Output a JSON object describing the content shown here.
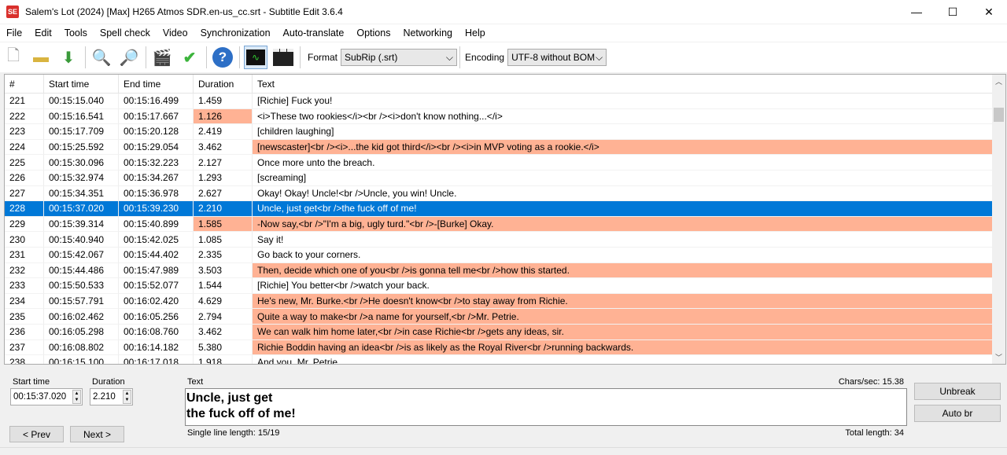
{
  "window": {
    "app_icon": "SE",
    "title": "Salem's Lot (2024) [Max] H265 Atmos SDR.en-us_cc.srt - Subtitle Edit 3.6.4",
    "minimize": "—",
    "maximize": "☐",
    "close": "✕"
  },
  "menu": [
    "File",
    "Edit",
    "Tools",
    "Spell check",
    "Video",
    "Synchronization",
    "Auto-translate",
    "Options",
    "Networking",
    "Help"
  ],
  "toolbar": {
    "format_label": "Format",
    "format_value": "SubRip (.srt)",
    "encoding_label": "Encoding",
    "encoding_value": "UTF-8 without BOM"
  },
  "colors": {
    "warning": "#ffb294",
    "selected": "#0078d7"
  },
  "grid": {
    "headers": [
      "#",
      "Start time",
      "End time",
      "Duration",
      "Text"
    ],
    "rows": [
      {
        "n": "221",
        "start": "00:15:15.040",
        "end": "00:15:16.499",
        "dur": "1.459",
        "text": "[Richie] Fuck you!",
        "dw": false,
        "tw": false
      },
      {
        "n": "222",
        "start": "00:15:16.541",
        "end": "00:15:17.667",
        "dur": "1.126",
        "text": "<i>These two rookies</i><br /><i>don't know nothing...</i>",
        "dw": true,
        "tw": false
      },
      {
        "n": "223",
        "start": "00:15:17.709",
        "end": "00:15:20.128",
        "dur": "2.419",
        "text": "[children laughing]",
        "dw": false,
        "tw": false
      },
      {
        "n": "224",
        "start": "00:15:25.592",
        "end": "00:15:29.054",
        "dur": "3.462",
        "text": "[newscaster]<br /><i>...the kid got third</i><br /><i>in MVP voting as a rookie.</i>",
        "dw": false,
        "tw": true
      },
      {
        "n": "225",
        "start": "00:15:30.096",
        "end": "00:15:32.223",
        "dur": "2.127",
        "text": "Once more unto the breach.",
        "dw": false,
        "tw": false
      },
      {
        "n": "226",
        "start": "00:15:32.974",
        "end": "00:15:34.267",
        "dur": "1.293",
        "text": "[screaming]",
        "dw": false,
        "tw": false
      },
      {
        "n": "227",
        "start": "00:15:34.351",
        "end": "00:15:36.978",
        "dur": "2.627",
        "text": "Okay! Okay! Uncle!<br />Uncle, you win! Uncle.",
        "dw": false,
        "tw": false
      },
      {
        "n": "228",
        "start": "00:15:37.020",
        "end": "00:15:39.230",
        "dur": "2.210",
        "text": "Uncle, just get<br />the fuck off of me!",
        "dw": false,
        "tw": false,
        "selected": true
      },
      {
        "n": "229",
        "start": "00:15:39.314",
        "end": "00:15:40.899",
        "dur": "1.585",
        "text": "-Now say,<br />\"I'm a big, ugly turd.\"<br />-[Burke] Okay.",
        "dw": true,
        "tw": true
      },
      {
        "n": "230",
        "start": "00:15:40.940",
        "end": "00:15:42.025",
        "dur": "1.085",
        "text": "Say it!",
        "dw": false,
        "tw": false
      },
      {
        "n": "231",
        "start": "00:15:42.067",
        "end": "00:15:44.402",
        "dur": "2.335",
        "text": "Go back to your corners.",
        "dw": false,
        "tw": false
      },
      {
        "n": "232",
        "start": "00:15:44.486",
        "end": "00:15:47.989",
        "dur": "3.503",
        "text": "Then, decide which one of you<br />is gonna tell me<br />how this started.",
        "dw": false,
        "tw": true
      },
      {
        "n": "233",
        "start": "00:15:50.533",
        "end": "00:15:52.077",
        "dur": "1.544",
        "text": "[Richie] You better<br />watch your back.",
        "dw": false,
        "tw": false
      },
      {
        "n": "234",
        "start": "00:15:57.791",
        "end": "00:16:02.420",
        "dur": "4.629",
        "text": "He's new, Mr. Burke.<br />He doesn't know<br />to stay away from Richie.",
        "dw": false,
        "tw": true
      },
      {
        "n": "235",
        "start": "00:16:02.462",
        "end": "00:16:05.256",
        "dur": "2.794",
        "text": "Quite a way to make<br />a name for yourself,<br />Mr. Petrie.",
        "dw": false,
        "tw": true
      },
      {
        "n": "236",
        "start": "00:16:05.298",
        "end": "00:16:08.760",
        "dur": "3.462",
        "text": "We can walk him home later,<br />in case Richie<br />gets any ideas, sir.",
        "dw": false,
        "tw": true
      },
      {
        "n": "237",
        "start": "00:16:08.802",
        "end": "00:16:14.182",
        "dur": "5.380",
        "text": "Richie Boddin having an idea<br />is as likely as the Royal River<br />running backwards.",
        "dw": false,
        "tw": true
      },
      {
        "n": "238",
        "start": "00:16:15.100",
        "end": "00:16:17.018",
        "dur": "1.918",
        "text": "And you, Mr. Petrie",
        "dw": false,
        "tw": false
      }
    ]
  },
  "editor": {
    "start_label": "Start time",
    "start_value": "00:15:37.020",
    "duration_label": "Duration",
    "duration_value": "2.210",
    "text_label": "Text",
    "line1": "Uncle, just get",
    "line2": "the fuck off of me!",
    "chars_sec": "Chars/sec: 15.38",
    "single_line": "Single line length: 15/19",
    "total_length": "Total length: 34",
    "prev": "< Prev",
    "next": "Next >",
    "unbreak": "Unbreak",
    "auto_br": "Auto br"
  }
}
